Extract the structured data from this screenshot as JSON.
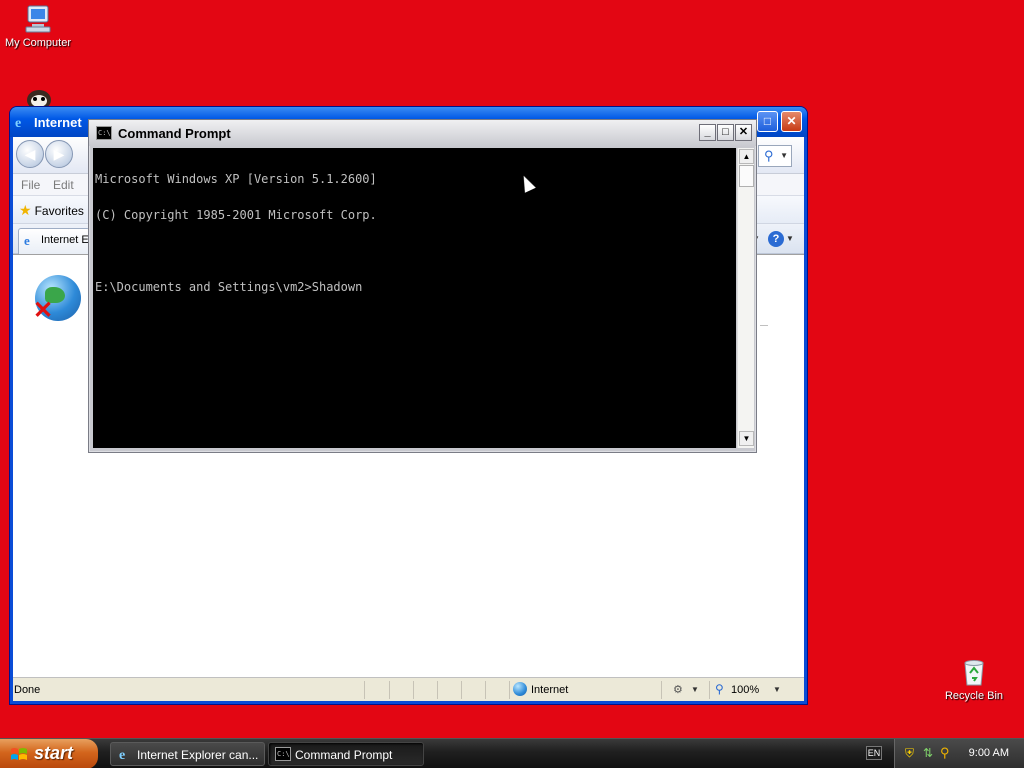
{
  "desktop": {
    "icons": [
      {
        "label": "My Computer",
        "icon": "my-computer-icon"
      },
      {
        "label": "Recycle Bin",
        "icon": "recycle-bin-icon"
      }
    ],
    "background_color": "#e30613"
  },
  "ie_window": {
    "title": "Internet",
    "menu": {
      "file": "File",
      "edit": "Edit"
    },
    "favorites_label": "Favorites",
    "tab_label": "Internet E",
    "status": {
      "text": "Done",
      "zone": "Internet",
      "zoom": "100%"
    },
    "help_label": "?"
  },
  "cmd_window": {
    "title": "Command Prompt",
    "lines": [
      "Microsoft Windows XP [Version 5.1.2600]",
      "(C) Copyright 1985-2001 Microsoft Corp.",
      "",
      "E:\\Documents and Settings\\vm2>Shadown"
    ]
  },
  "taskbar": {
    "start_label": "start",
    "buttons": [
      {
        "label": "Internet Explorer can...",
        "icon": "ie-icon",
        "active": false
      },
      {
        "label": "Command Prompt",
        "icon": "cmd-icon",
        "active": true
      }
    ],
    "language": "EN",
    "clock": "9:00 AM"
  }
}
